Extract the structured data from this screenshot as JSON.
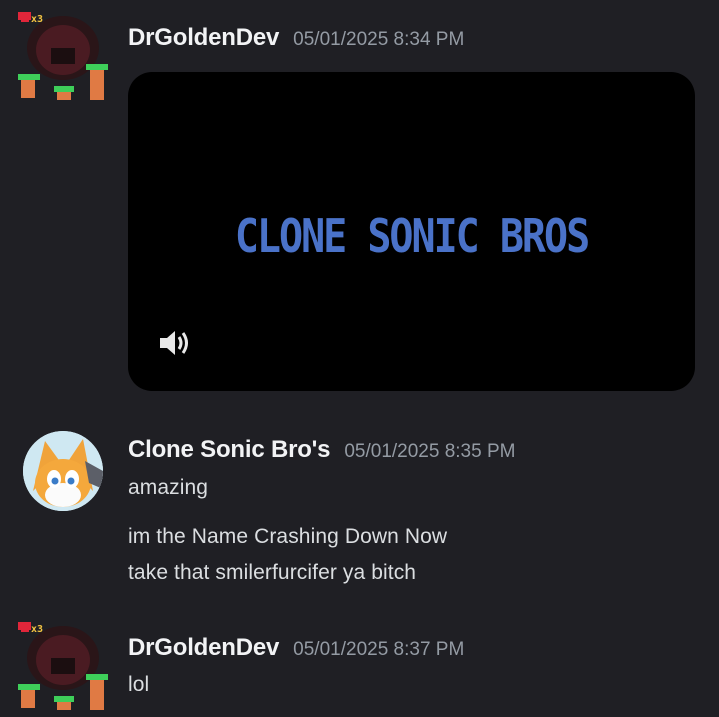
{
  "messages": [
    {
      "author": "DrGoldenDev",
      "timestamp": "05/01/2025 8:34 PM",
      "avatar_icon": "pixel-character-avatar-icon",
      "badge": "x3",
      "attachment": {
        "type": "video",
        "title_text": "CLONE SONIC BROS",
        "title_color": "#4a72c8",
        "volume_icon": "speaker-icon"
      }
    },
    {
      "author": "Clone Sonic Bro's",
      "timestamp": "05/01/2025 8:35 PM",
      "avatar_icon": "tails-avatar-icon",
      "lines": [
        "amazing",
        "im the Name Crashing Down Now",
        "take that smilerfurcifer ya bitch"
      ]
    },
    {
      "author": "DrGoldenDev",
      "timestamp": "05/01/2025 8:37 PM",
      "avatar_icon": "pixel-character-avatar-icon",
      "badge": "x3",
      "lines": [
        "lol"
      ]
    }
  ],
  "theme": {
    "background": "#1f1f24",
    "author_color": "#f2f3f5",
    "timestamp_color": "#949ba4"
  }
}
